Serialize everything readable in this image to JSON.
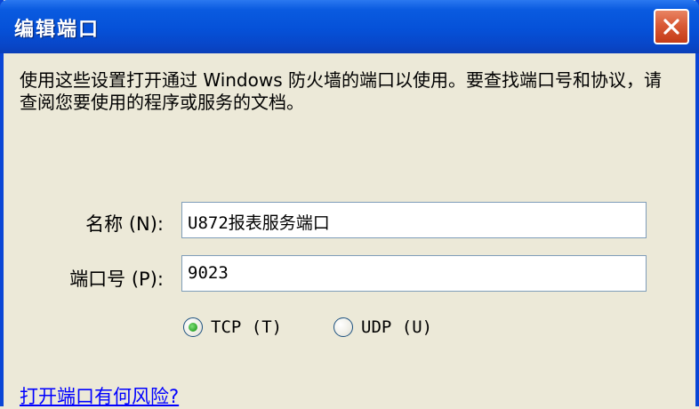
{
  "window": {
    "title": "编辑端口"
  },
  "description": "使用这些设置打开通过 Windows 防火墙的端口以使用。要查找端口号和协议，请查阅您要使用的程序或服务的文档。",
  "form": {
    "name_label": "名称 (N):",
    "name_value": "U872报表服务端口",
    "port_label": "端口号 (P):",
    "port_value": "9023",
    "protocol": {
      "selected": "TCP",
      "tcp_label": "TCP (T)",
      "udp_label": "UDP (U)"
    }
  },
  "risk_link": "打开端口有何风险?",
  "icons": {
    "close": "close-icon"
  },
  "colors": {
    "titlebar": "#0551d8",
    "dialog_bg": "#ece9d8",
    "close_button": "#d95a36",
    "link": "#0000ff",
    "radio_selected": "#2ea52a"
  }
}
